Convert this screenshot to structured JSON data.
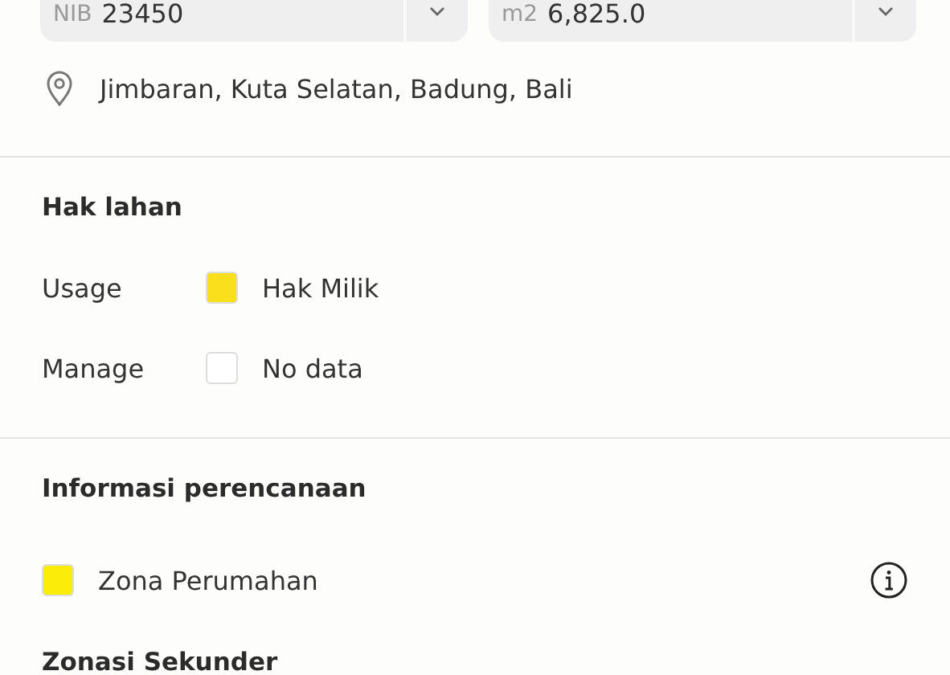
{
  "fields": [
    {
      "unit": "NIB",
      "value": "23450"
    },
    {
      "unit": "m2",
      "value": "6,825.0"
    }
  ],
  "location": "Jimbaran, Kuta Selatan, Badung, Bali",
  "hak_lahan": {
    "title": "Hak lahan",
    "rows": [
      {
        "label": "Usage",
        "color": "#f9df1c",
        "value": "Hak Milik"
      },
      {
        "label": "Manage",
        "color": "#ffffff",
        "value": "No data"
      }
    ]
  },
  "perencanaan": {
    "title": "Informasi perencanaan",
    "zones": [
      {
        "color": "#fcec0a",
        "name": "Zona Perumahan"
      }
    ],
    "next_heading": "Zonasi Sekunder"
  }
}
